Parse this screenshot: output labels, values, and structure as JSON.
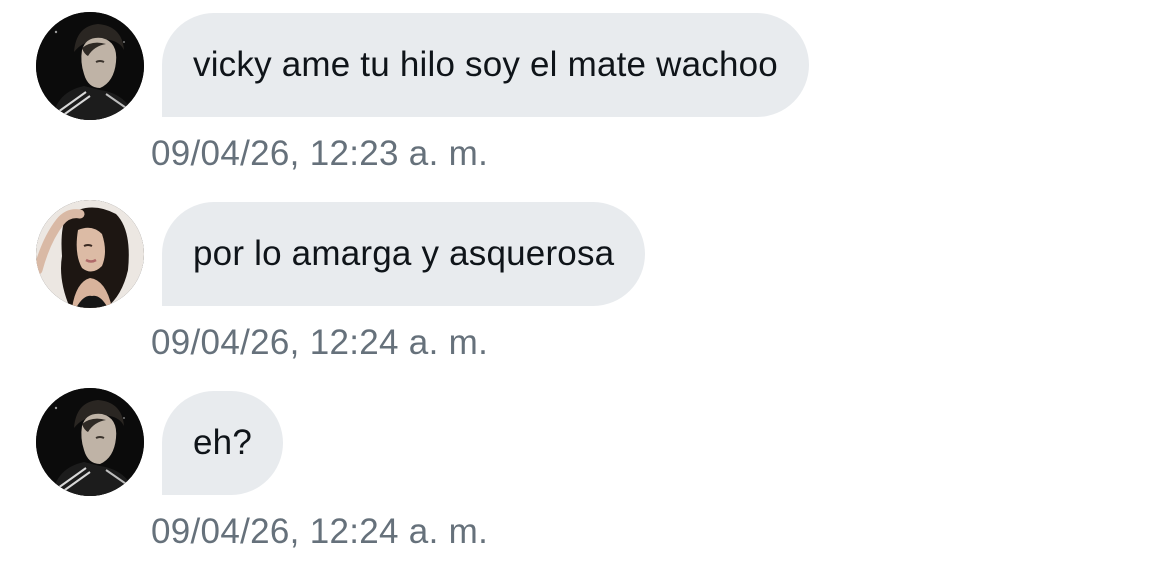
{
  "messages": [
    {
      "sender_avatar": "avatar-dark-haired-person-icon",
      "text": "vicky ame tu hilo soy el mate wachoo",
      "timestamp": "09/04/26, 12:23 a. m."
    },
    {
      "sender_avatar": "avatar-woman-posing-icon",
      "text": "por lo amarga y asquerosa",
      "timestamp": "09/04/26, 12:24 a. m."
    },
    {
      "sender_avatar": "avatar-dark-haired-person-icon",
      "text": "eh?",
      "timestamp": "09/04/26, 12:24 a. m."
    }
  ],
  "colors": {
    "bubble_background": "#e8ebee",
    "message_text": "#0f1419",
    "timestamp_text": "#66717b",
    "page_background": "#ffffff"
  }
}
